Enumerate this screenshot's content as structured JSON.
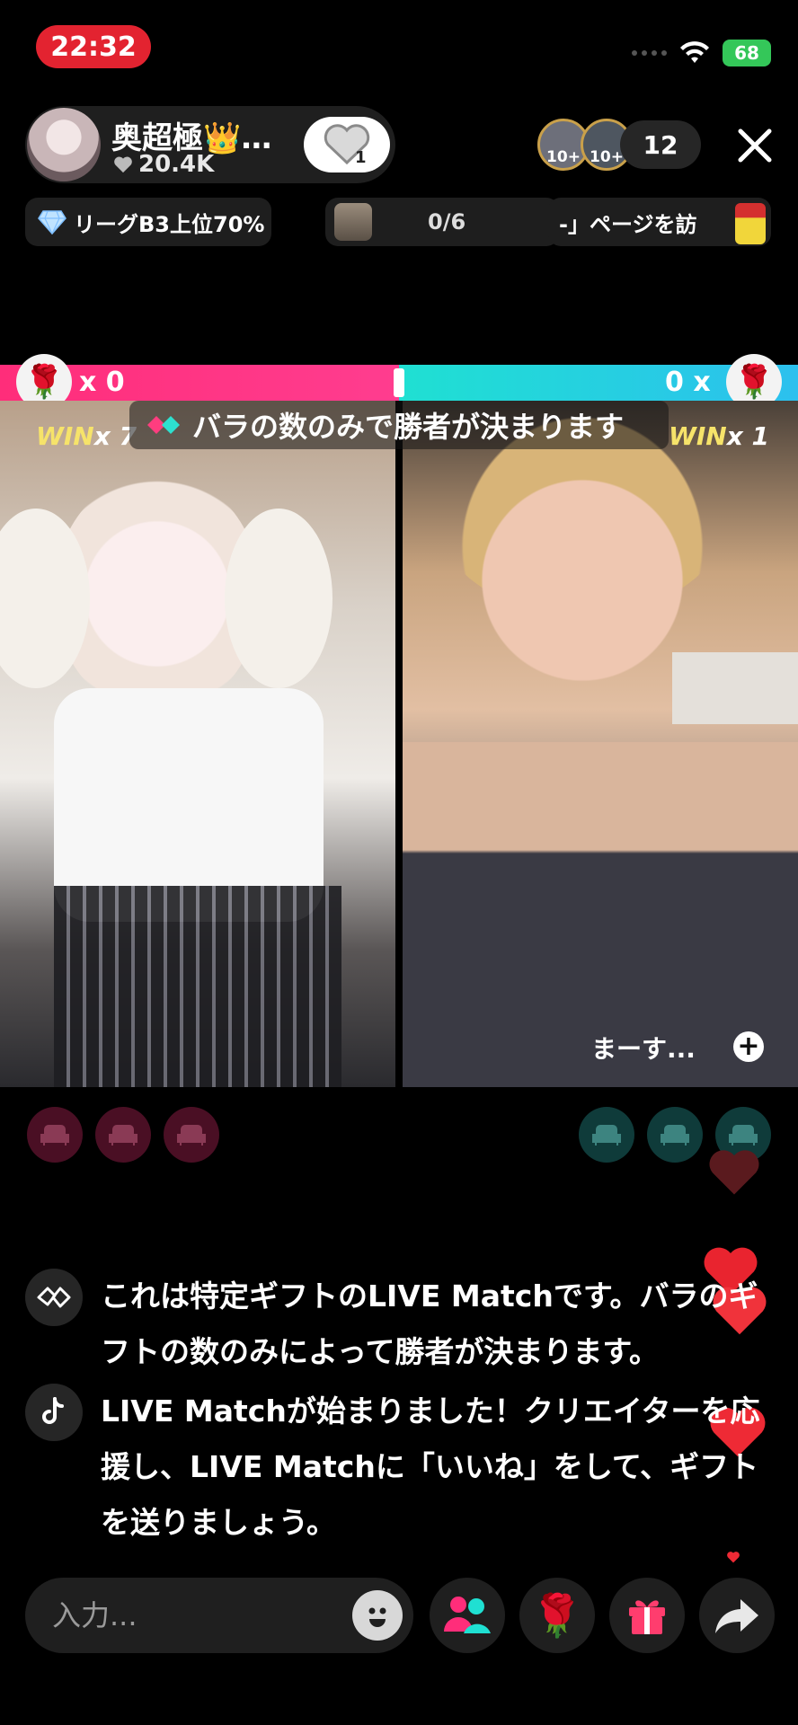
{
  "status_bar": {
    "time": "22:32",
    "battery": "68"
  },
  "host": {
    "name": "奥超極👑…",
    "likes": "20.4K",
    "follow_badge": "1"
  },
  "viewers": {
    "badges": [
      "10+",
      "10+"
    ],
    "count": "12"
  },
  "info_row": {
    "league": "リーグB3上位70%",
    "goal_progress": "0/6",
    "ticker": "-」ページを訪"
  },
  "battle": {
    "left_score": "x 0",
    "right_score": "0 x",
    "left_win_label": "WIN",
    "left_win_count": "x 7",
    "right_win_label": "WIN",
    "right_win_count": "x 1",
    "banner": "バラの数のみで勝者が決まります",
    "guest_name": "まーす...",
    "colors": {
      "left": "#ff2d7a",
      "right": "#1fe0d2"
    }
  },
  "chat": [
    {
      "icon": "match-handshake-icon",
      "text": "これは特定ギフトのLIVE Matchです。バラのギフトの数のみによって勝者が決まります。"
    },
    {
      "icon": "tiktok-icon",
      "text": "LIVE Matchが始まりました！クリエイターを応援し、LIVE Matchに「いいね」をして、ギフトを送りましょう。"
    }
  ],
  "input": {
    "placeholder": "入力..."
  }
}
